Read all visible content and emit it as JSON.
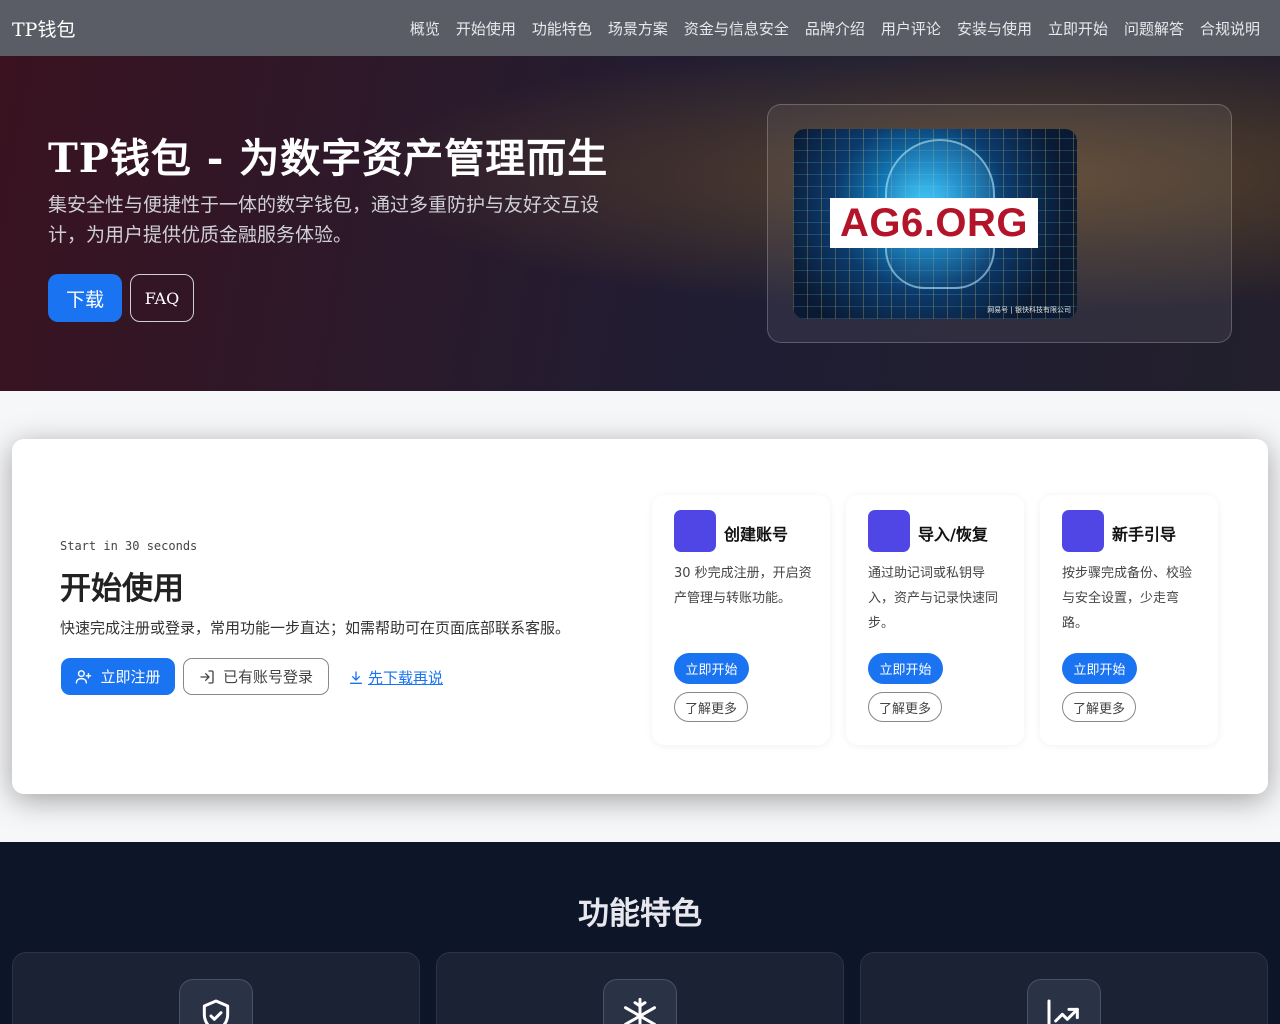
{
  "nav": {
    "brand": "TP钱包",
    "links": [
      "概览",
      "开始使用",
      "功能特色",
      "场景方案",
      "资金与信息安全",
      "品牌介绍",
      "用户评论",
      "安装与使用",
      "立即开始",
      "问题解答",
      "合规说明"
    ]
  },
  "hero": {
    "title": "TP钱包 - 为数字资产管理而生",
    "description": "集安全性与便捷性于一体的数字钱包，通过多重防护与友好交互设计，为用户提供优质金融服务体验。",
    "download_label": "下载",
    "faq_label": "FAQ",
    "image_logo_text": "AG6.ORG",
    "image_watermark": "网易号 | 银快科技有限公司"
  },
  "start": {
    "eyebrow": "Start in 30 seconds",
    "title": "开始使用",
    "description": "快速完成注册或登录，常用功能一步直达；如需帮助可在页面底部联系客服。",
    "register_label": "立即注册",
    "login_label": "已有账号登录",
    "download_link": "先下载再说",
    "steps": [
      {
        "title": "创建账号",
        "desc": "30 秒完成注册，开启资产管理与转账功能。",
        "start": "立即开始",
        "more": "了解更多"
      },
      {
        "title": "导入/恢复",
        "desc": "通过助记词或私钥导入，资产与记录快速同步。",
        "start": "立即开始",
        "more": "了解更多"
      },
      {
        "title": "新手引导",
        "desc": "按步骤完成备份、校验与安全设置，少走弯路。",
        "start": "立即开始",
        "more": "了解更多"
      }
    ]
  },
  "features": {
    "title": "功能特色",
    "icons": [
      "shield-check-icon",
      "snowflake-icon",
      "trending-up-icon"
    ]
  },
  "colors": {
    "primary": "#1a73f0",
    "step_icon": "#4f46e5",
    "nav_bg": "#5a5d66",
    "features_bg": "#0d1528"
  }
}
